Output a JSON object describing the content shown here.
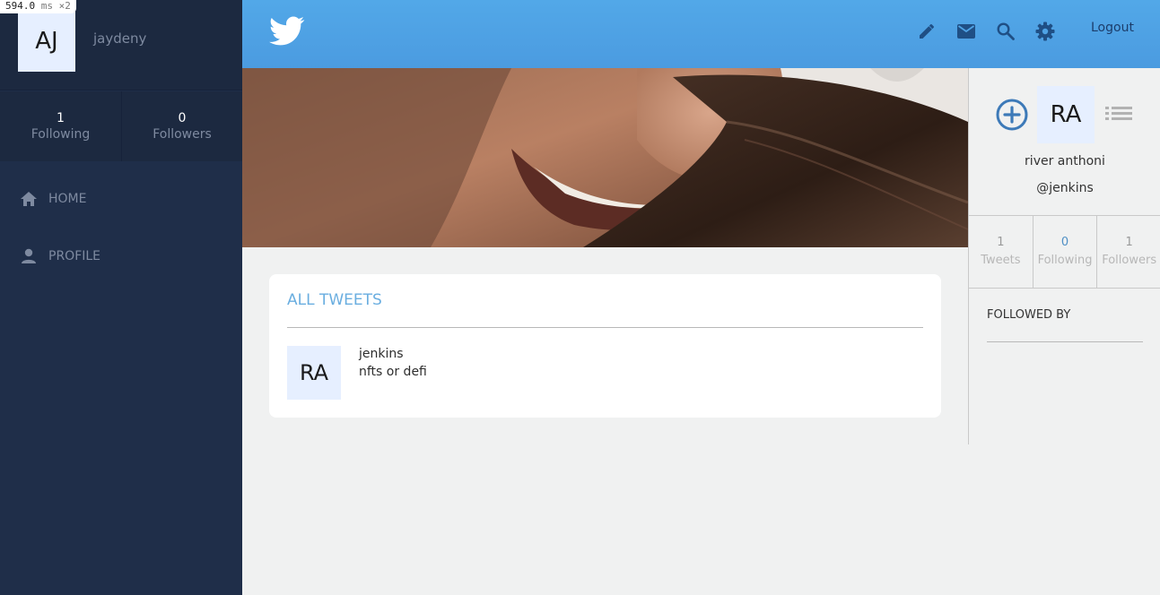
{
  "debug": {
    "value": "594.0",
    "unit": "ms",
    "multiplier": "×2"
  },
  "sidebar": {
    "user": {
      "initials": "AJ",
      "name": "jaydeny"
    },
    "stats": [
      {
        "value": "1",
        "label": "Following"
      },
      {
        "value": "0",
        "label": "Followers"
      }
    ],
    "nav": [
      {
        "label": "HOME",
        "icon": "home-icon"
      },
      {
        "label": "PROFILE",
        "icon": "person-icon"
      }
    ]
  },
  "header": {
    "logo": "twitter-bird-icon",
    "icons": [
      "pencil-icon",
      "mail-icon",
      "search-icon",
      "gear-icon"
    ],
    "logout_label": "Logout"
  },
  "feed": {
    "title": "ALL TWEETS",
    "tweets": [
      {
        "initials": "RA",
        "username": "jenkins",
        "text": "nfts or defi"
      }
    ]
  },
  "profile": {
    "initials": "RA",
    "name": "river anthoni",
    "handle": "@jenkins",
    "stats": [
      {
        "value": "1",
        "label": "Tweets"
      },
      {
        "value": "0",
        "label": "Following"
      },
      {
        "value": "1",
        "label": "Followers"
      }
    ],
    "followed_by_label": "FOLLOWED BY"
  },
  "colors": {
    "sidebar_bg": "#1f2e49",
    "header_bg": "#4fa3e6",
    "accent": "#6aaee0"
  }
}
